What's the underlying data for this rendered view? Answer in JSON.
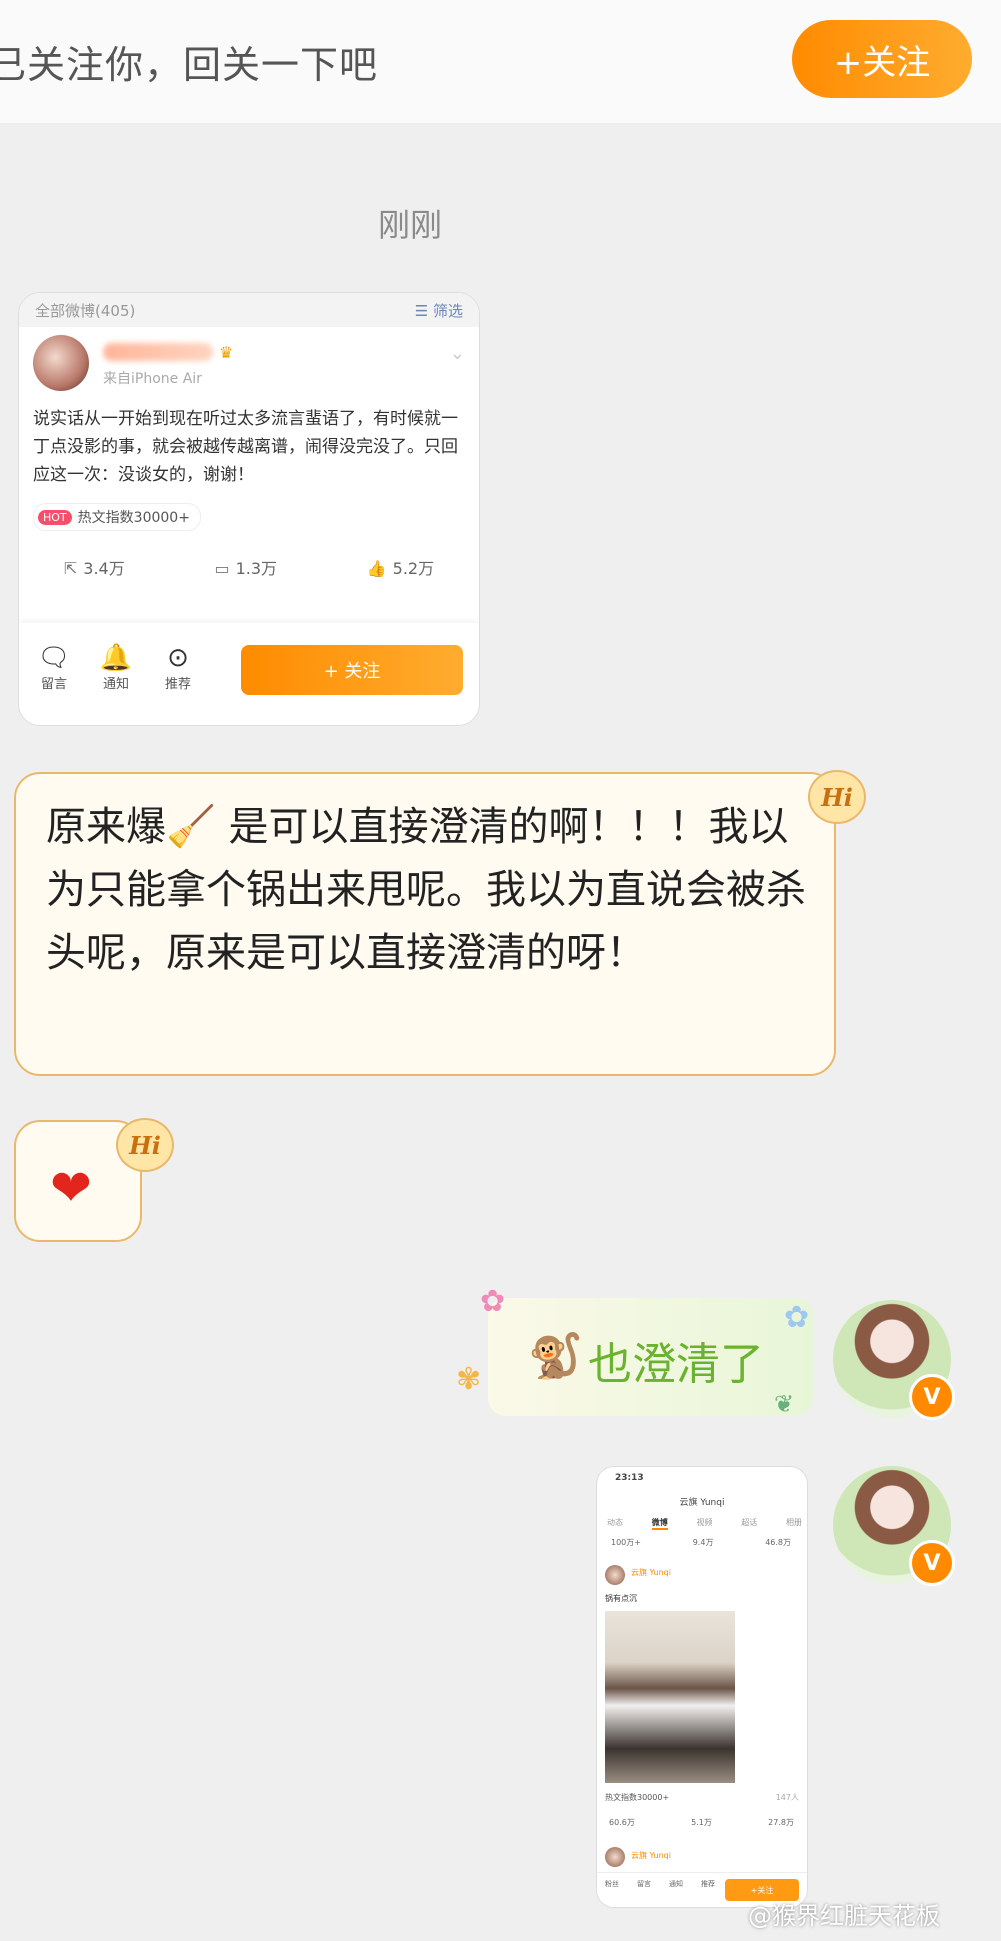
{
  "header": {
    "message": "已关注你，回关一下吧",
    "follow_label": "+关注"
  },
  "timestamp": "刚刚",
  "shared_card": {
    "tab_label": "全部微博(405)",
    "filter_label": "筛选",
    "source": "来自iPhone Air",
    "post_text": "说实话从一开始到现在听过太多流言蜚语了，有时候就一丁点没影的事，就会被越传越离谱，闹得没完没了。只回应这一次：没谈女的，谢谢！",
    "hot_pill": "HOT",
    "hot_label": "热文指数30000+",
    "reposts": "3.4万",
    "comments": "1.3万",
    "likes": "5.2万",
    "bar": [
      {
        "icon": "comment-box-icon",
        "label": "留言"
      },
      {
        "icon": "bell-icon",
        "label": "通知"
      },
      {
        "icon": "recommend-icon",
        "label": "推荐"
      }
    ],
    "follow_label": "+ 关注"
  },
  "messages": {
    "hi_badge": "Hi",
    "incoming_1": "原来爆🧹 是可以直接澄清的啊！！！我以为只能拿个锅出来甩呢。我以为直说会被杀头呢，原来是可以直接澄清的呀！",
    "incoming_2": "❤",
    "outgoing_1": "也澄清了",
    "outgoing_1_emoji": "🐒",
    "verified_badge": "V"
  },
  "phone_screenshot": {
    "time": "23:13",
    "title": "云旗 Yunqi",
    "tabs": [
      "动态",
      "微博",
      "视频",
      "超话",
      "相册"
    ],
    "active_tab": "微博",
    "counts": [
      "100万+",
      "9.4万",
      "46.8万"
    ],
    "user": "云旗 Yunqi",
    "post_text": "锅有点沉",
    "hot_label": "热文指数30000+",
    "likes_count": "147人",
    "reposts": "60.6万",
    "comments": "5.1万",
    "likes": "27.8万",
    "bar_items": [
      "粉丝",
      "留言",
      "通知",
      "推荐"
    ],
    "follow_label": "+关注"
  },
  "watermark": "@猴界红脏天花板",
  "colors": {
    "accent_orange": "#ff8b00",
    "bubble_border": "#e9b86a",
    "green_text": "#6bb32e",
    "background": "#efefef"
  }
}
